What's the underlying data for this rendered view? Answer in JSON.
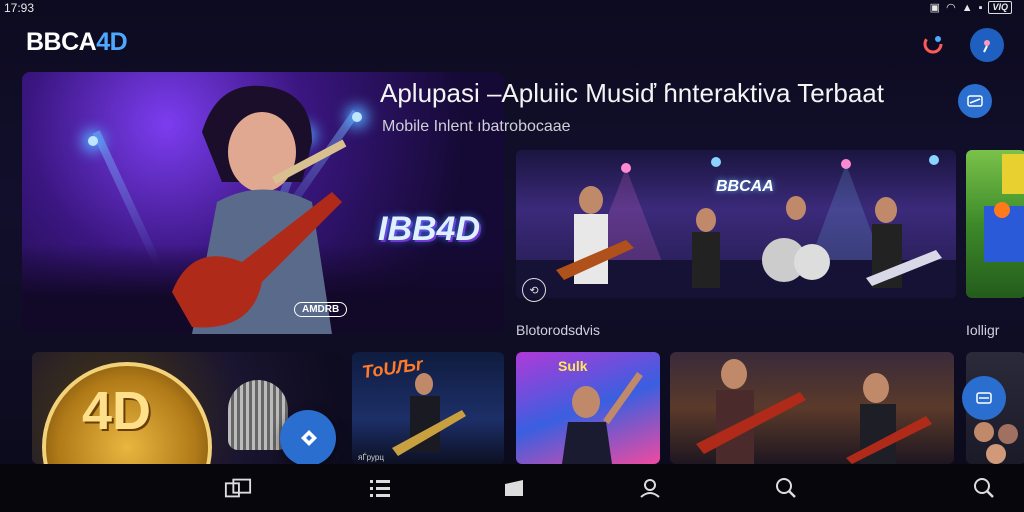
{
  "status_bar": {
    "time": "17:93",
    "battery_label": "VIQ"
  },
  "header": {
    "logo_main": "BBCA",
    "logo_accent": "4D"
  },
  "hero": {
    "title": "Aplupasi –Apluiic  Musiď ɦnteraktiva Terbaat",
    "subtitle": "Mobile Inlent ıbatrobocaae",
    "badge": "IBB4D",
    "tag": "AMDRB"
  },
  "concert": {
    "logo": "BBCAA"
  },
  "sections": {
    "left_label": "Blotorodsdvis",
    "right_label": "Iolligr"
  },
  "cards": {
    "c2_title": "ToUЉr",
    "c2_caption": "яЃрурц",
    "c3_title": "Sulk"
  },
  "coin_text": "4D",
  "nav": [
    "library",
    "list",
    "home",
    "profile",
    "search",
    "search-person"
  ]
}
